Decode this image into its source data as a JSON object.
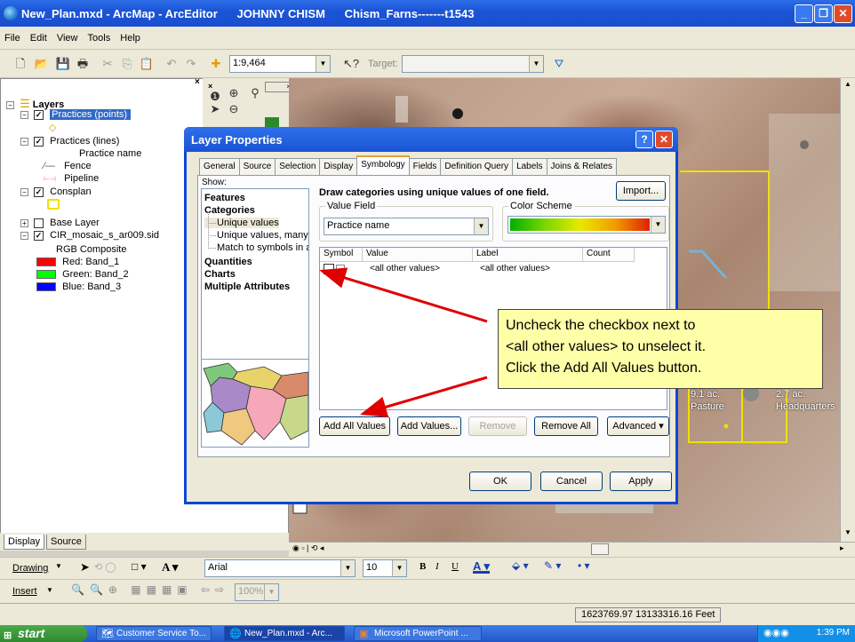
{
  "window": {
    "title": "New_Plan.mxd - ArcMap - ArcEditor      JOHNNY CHISM      Chism_Farns-------t1543"
  },
  "menu": [
    "File",
    "Edit",
    "View",
    "Tools",
    "Help"
  ],
  "toolbar": {
    "scale": "1:9,464",
    "target_label": "Target:"
  },
  "toc": {
    "root": "Layers",
    "items": [
      {
        "label": "Practices (points)",
        "selected": true
      },
      {
        "label": "Practices (lines)"
      },
      {
        "label": "Practice name"
      },
      {
        "label": "Fence"
      },
      {
        "label": "Pipeline"
      },
      {
        "label": "Consplan"
      },
      {
        "label": "Base Layer"
      },
      {
        "label": "CIR_mosaic_s_ar009.sid"
      },
      {
        "label": "RGB Composite"
      },
      {
        "label": "Red:   Band_1",
        "color": "#ff0000"
      },
      {
        "label": "Green: Band_2",
        "color": "#00ff00"
      },
      {
        "label": "Blue:   Band_3",
        "color": "#0000ff"
      }
    ],
    "tabs": [
      "Display",
      "Source"
    ]
  },
  "dialog": {
    "title": "Layer Properties",
    "tabs": [
      "General",
      "Source",
      "Selection",
      "Display",
      "Symbology",
      "Fields",
      "Definition Query",
      "Labels",
      "Joins & Relates"
    ],
    "active_tab": "Symbology",
    "show_label": "Show:",
    "show_items": [
      {
        "label": "Features",
        "type": "bold"
      },
      {
        "label": "Categories",
        "type": "bold"
      },
      {
        "label": "Unique values",
        "type": "sub",
        "selected": true
      },
      {
        "label": "Unique values, many f",
        "type": "sub"
      },
      {
        "label": "Match to symbols in a",
        "type": "sub"
      },
      {
        "label": "Quantities",
        "type": "bold"
      },
      {
        "label": "Charts",
        "type": "bold"
      },
      {
        "label": "Multiple Attributes",
        "type": "bold"
      }
    ],
    "heading": "Draw categories using unique values of one field.",
    "import_label": "Import...",
    "value_field_label": "Value Field",
    "value_field": "Practice name",
    "color_scheme_label": "Color Scheme",
    "columns": [
      "Symbol",
      "Value",
      "Label",
      "Count"
    ],
    "rows": [
      {
        "value": "<all other values>",
        "label": "<all other values>",
        "checked": false
      }
    ],
    "buttons": {
      "add_all": "Add All Values",
      "add": "Add Values...",
      "remove": "Remove",
      "remove_all": "Remove All",
      "advanced": "Advanced"
    },
    "ok": "OK",
    "cancel": "Cancel",
    "apply": "Apply"
  },
  "callout": {
    "line1": "Uncheck the checkbox next to",
    "line2": "<all other values> to unselect it.",
    "line3": "Click the Add All Values button."
  },
  "map_labels": {
    "pasture_1": "9.1 ac.",
    "pasture_2": "Pasture",
    "hq_1": "2.7 ac.",
    "hq_2": "Headquarters"
  },
  "drawing": {
    "drawing_label": "Drawing",
    "font": "Arial",
    "size": "10",
    "insert_label": "Insert",
    "zoom": "100%"
  },
  "status": {
    "coords": "1623769.97  13133316.16 Feet"
  },
  "taskbar": {
    "start": "start",
    "tasks": [
      "Customer Service To...",
      "New_Plan.mxd - Arc...",
      "Microsoft PowerPoint ..."
    ],
    "clock": "1:39 PM"
  }
}
